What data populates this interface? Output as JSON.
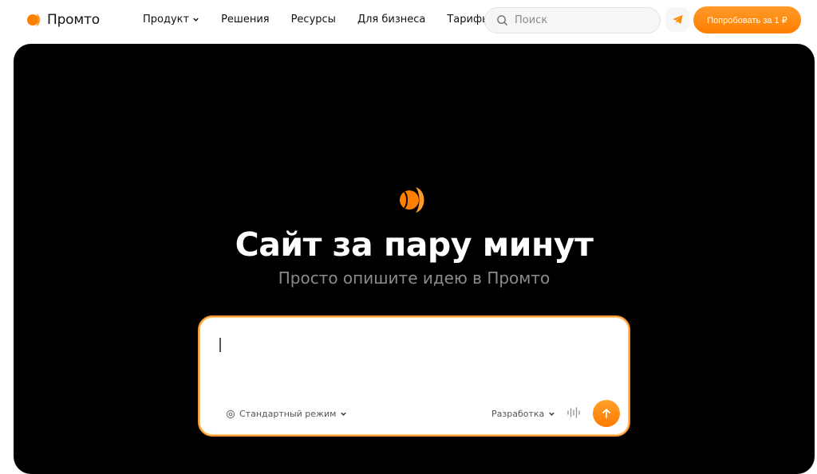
{
  "header": {
    "brand": "Промто",
    "nav": [
      {
        "label": "Продукт",
        "has_chevron": true
      },
      {
        "label": "Решения",
        "has_chevron": false
      },
      {
        "label": "Ресурсы",
        "has_chevron": false
      },
      {
        "label": "Для бизнеса",
        "has_chevron": false
      },
      {
        "label": "Тарифы",
        "has_chevron": false
      }
    ],
    "search_placeholder": "Поиск",
    "telegram_icon": "telegram-icon",
    "cta_label": "Попробовать за 1 ₽"
  },
  "hero": {
    "title": "Сайт за пару минут",
    "subtitle": "Просто опишите идею в Промто",
    "prompt": {
      "value": "",
      "mode_label": "Стандартный режим",
      "dev_label": "Разработка"
    }
  },
  "colors": {
    "accent": "#ff8a00",
    "hero_bg": "#000000",
    "subtitle": "#8b8b8b"
  }
}
